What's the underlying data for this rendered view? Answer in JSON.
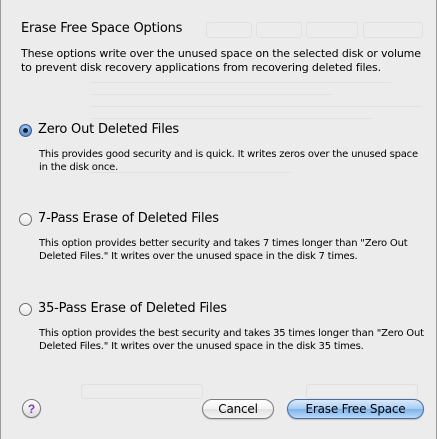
{
  "dialog": {
    "title": "Erase Free Space Options",
    "intro": "These options write over the unused space on the selected disk or volume to prevent disk recovery applications from recovering deleted files."
  },
  "options": [
    {
      "label": "Zero Out Deleted Files",
      "description": "This provides good security and is quick. It writes zeros over the unused space in the disk once.",
      "selected": true
    },
    {
      "label": "7-Pass Erase of Deleted Files",
      "description": "This option provides better security and takes 7 times longer than \"Zero Out Deleted Files.\" It writes over the unused space in the disk 7 times.",
      "selected": false
    },
    {
      "label": "35-Pass Erase of Deleted Files",
      "description": "This option provides the best security and takes 35 times longer than \"Zero Out Deleted Files.\" It writes over the unused space in the disk 35 times.",
      "selected": false
    }
  ],
  "buttons": {
    "help_icon": "question-mark",
    "help_glyph": "?",
    "cancel_label": "Cancel",
    "erase_label": "Erase Free Space"
  },
  "colors": {
    "sheet_background": "#ececec",
    "selected_radio": "#6fa0dc",
    "default_button": "#a9cdf3"
  }
}
